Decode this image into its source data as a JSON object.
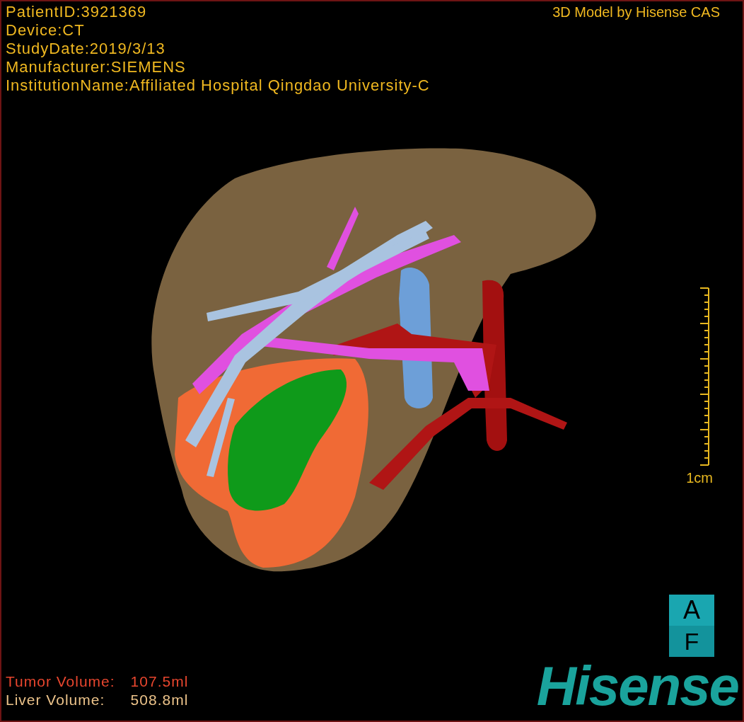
{
  "patient_info": [
    "PatientID:3921369",
    "Device:CT",
    "StudyDate:2019/3/13",
    "Manufacturer:SIEMENS",
    "InstitutionName:Affiliated Hospital Qingdao University-C"
  ],
  "credit": "3D Model by Hisense CAS",
  "scale_bar": {
    "label": "1cm"
  },
  "volumes": [
    {
      "label": "Tumor Volume:",
      "value": "107.5ml",
      "color": "#e8462e"
    },
    {
      "label": "Liver Volume:",
      "value": "508.8ml",
      "color": "#ecc38a"
    }
  ],
  "orientation_cube": {
    "top": "A",
    "bottom": "F"
  },
  "logo": "Hisense"
}
